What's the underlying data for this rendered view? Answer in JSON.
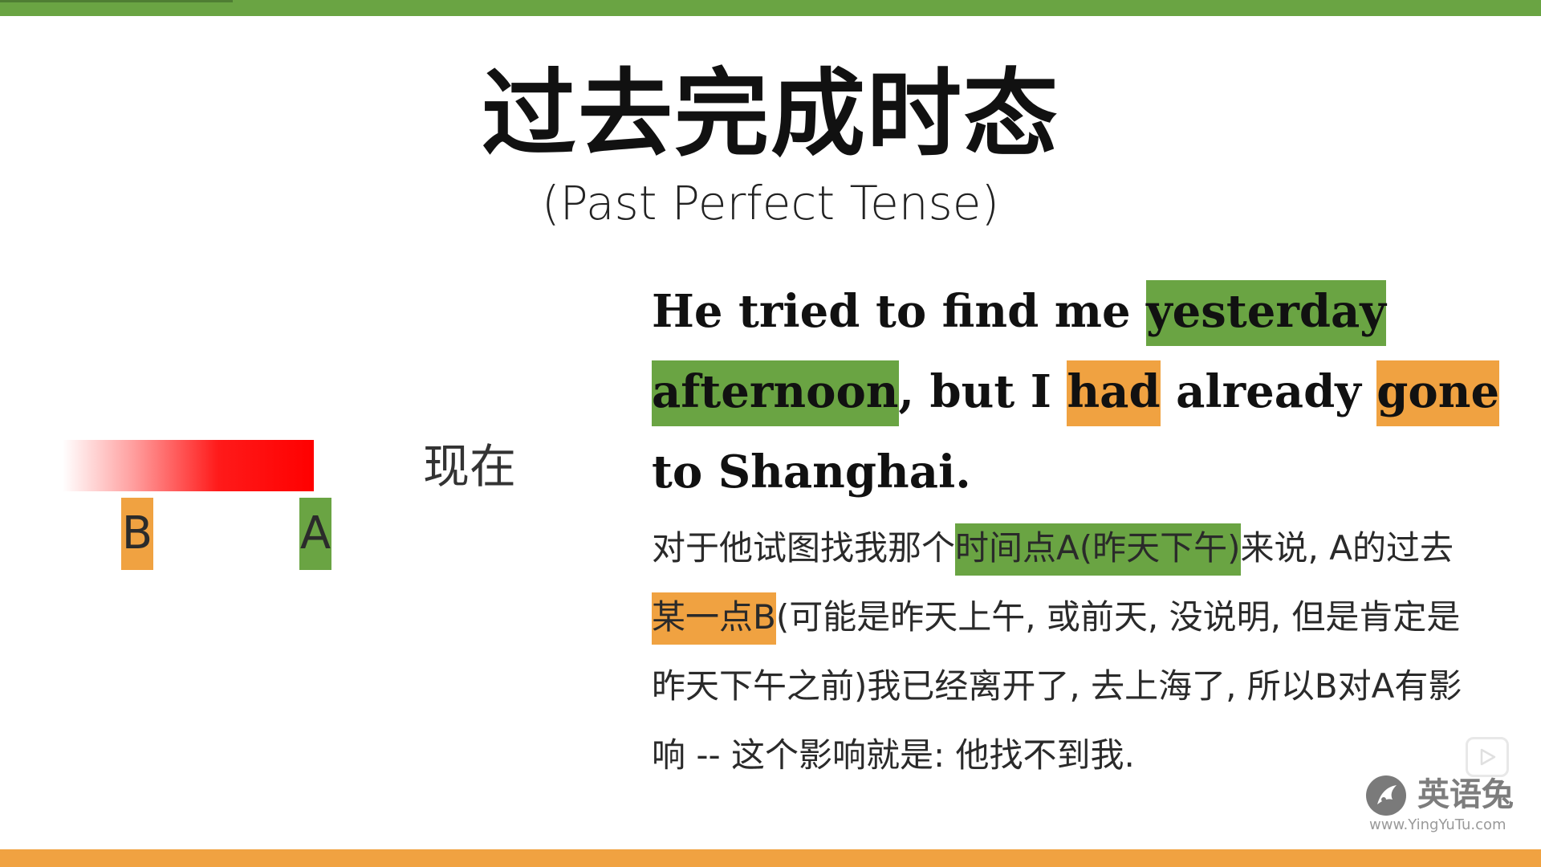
{
  "title": "过去完成时态",
  "subtitle": "(Past Perfect Tense)",
  "timeline": {
    "marker_b": "B",
    "marker_a": "A",
    "now_label": "现在"
  },
  "sentence": {
    "part1": "He tried to find me ",
    "hl_yesterday": "yesterday",
    "hl_afternoon": "afternoon",
    "part2": ", but I ",
    "hl_had": "had",
    "part3": " already ",
    "hl_gone": "gone",
    "part4": " to Shanghai."
  },
  "explanation": {
    "part1": "对于他试图找我那个",
    "hl_time_point_a": "时间点A(昨天下午)",
    "part2": "来说, A的过去",
    "hl_point_b": "某一点B",
    "part3": "(可能是昨天上午, 或前天, 没说明, 但是肯定是昨天下午之前)我已经离开了, 去上海了, 所以B对A有影响 -- 这个影响就是: 他找不到我."
  },
  "watermark": {
    "name": "英语兔",
    "url": "www.YingYuTu.com"
  },
  "colors": {
    "green": "#6aa443",
    "orange": "#f0a241",
    "red": "#ff0000"
  },
  "icons": [
    "play-icon",
    "logo-rabbit-icon"
  ]
}
